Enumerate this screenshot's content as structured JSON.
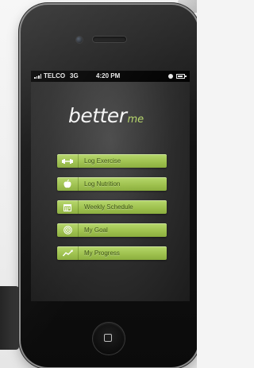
{
  "status_bar": {
    "carrier": "TELCO",
    "network": "3G",
    "time": "4:20 PM",
    "signal_icon": "signal-bars-icon",
    "battery_icon": "battery-icon",
    "battery_level": 0.8
  },
  "app": {
    "logo_main": "better",
    "logo_sub": "me",
    "accent_color": "#a6c95b",
    "label_color": "#3c5312"
  },
  "menu": {
    "items": [
      {
        "label": "Log Exercise",
        "icon": "dumbbell-icon"
      },
      {
        "label": "Log Nutrition",
        "icon": "apple-icon"
      },
      {
        "label": "Weekly Schedule",
        "icon": "calendar-icon"
      },
      {
        "label": "My Goal",
        "icon": "target-icon"
      },
      {
        "label": "My Progress",
        "icon": "progress-chart-icon"
      }
    ]
  },
  "device": {
    "home_button_icon": "home-square-icon"
  }
}
